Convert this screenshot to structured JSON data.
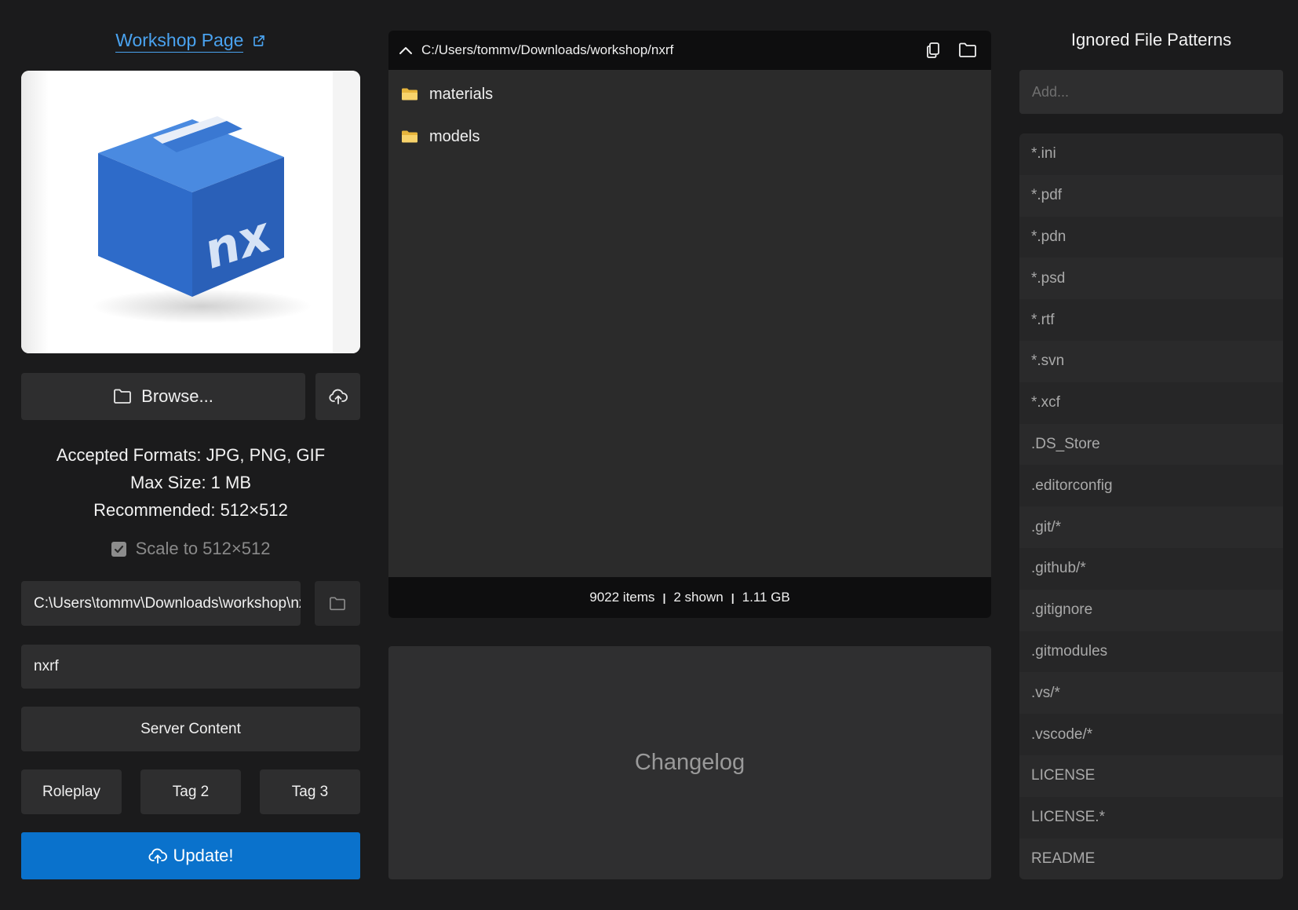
{
  "left": {
    "workshop_link": "Workshop Page",
    "browse_label": "Browse...",
    "formats_line1": "Accepted Formats: JPG, PNG, GIF",
    "formats_line2": "Max Size: 1 MB",
    "formats_line3": "Recommended: 512×512",
    "scale_label": "Scale to 512×512",
    "path_value": "C:\\Users\\tommv\\Downloads\\workshop\\nxrf",
    "name_value": "nxrf",
    "server_content_label": "Server Content",
    "tags": [
      "Roleplay",
      "Tag 2",
      "Tag 3"
    ],
    "update_label": "Update!",
    "preview_logo_text": "nx"
  },
  "browser": {
    "path": "C:/Users/tommv/Downloads/workshop/nxrf",
    "entries": [
      "materials",
      "models"
    ],
    "footer": {
      "items": "9022 items",
      "shown": "2 shown",
      "size": "1.11 GB"
    },
    "icons": [
      "chevron-up-icon",
      "copy-icon",
      "folder-icon"
    ]
  },
  "changelog": {
    "placeholder": "Changelog"
  },
  "ignored": {
    "title": "Ignored File Patterns",
    "add_placeholder": "Add...",
    "patterns": [
      "*.ini",
      "*.pdf",
      "*.pdn",
      "*.psd",
      "*.rtf",
      "*.svn",
      "*.xcf",
      ".DS_Store",
      ".editorconfig",
      ".git/*",
      ".github/*",
      ".gitignore",
      ".gitmodules",
      ".vs/*",
      ".vscode/*",
      "LICENSE",
      "LICENSE.*",
      "README"
    ]
  },
  "colors": {
    "background": "#1b1b1c",
    "accent": "#0a72cc",
    "link": "#4aa3f0",
    "box_blue": "#2f6fd0"
  }
}
